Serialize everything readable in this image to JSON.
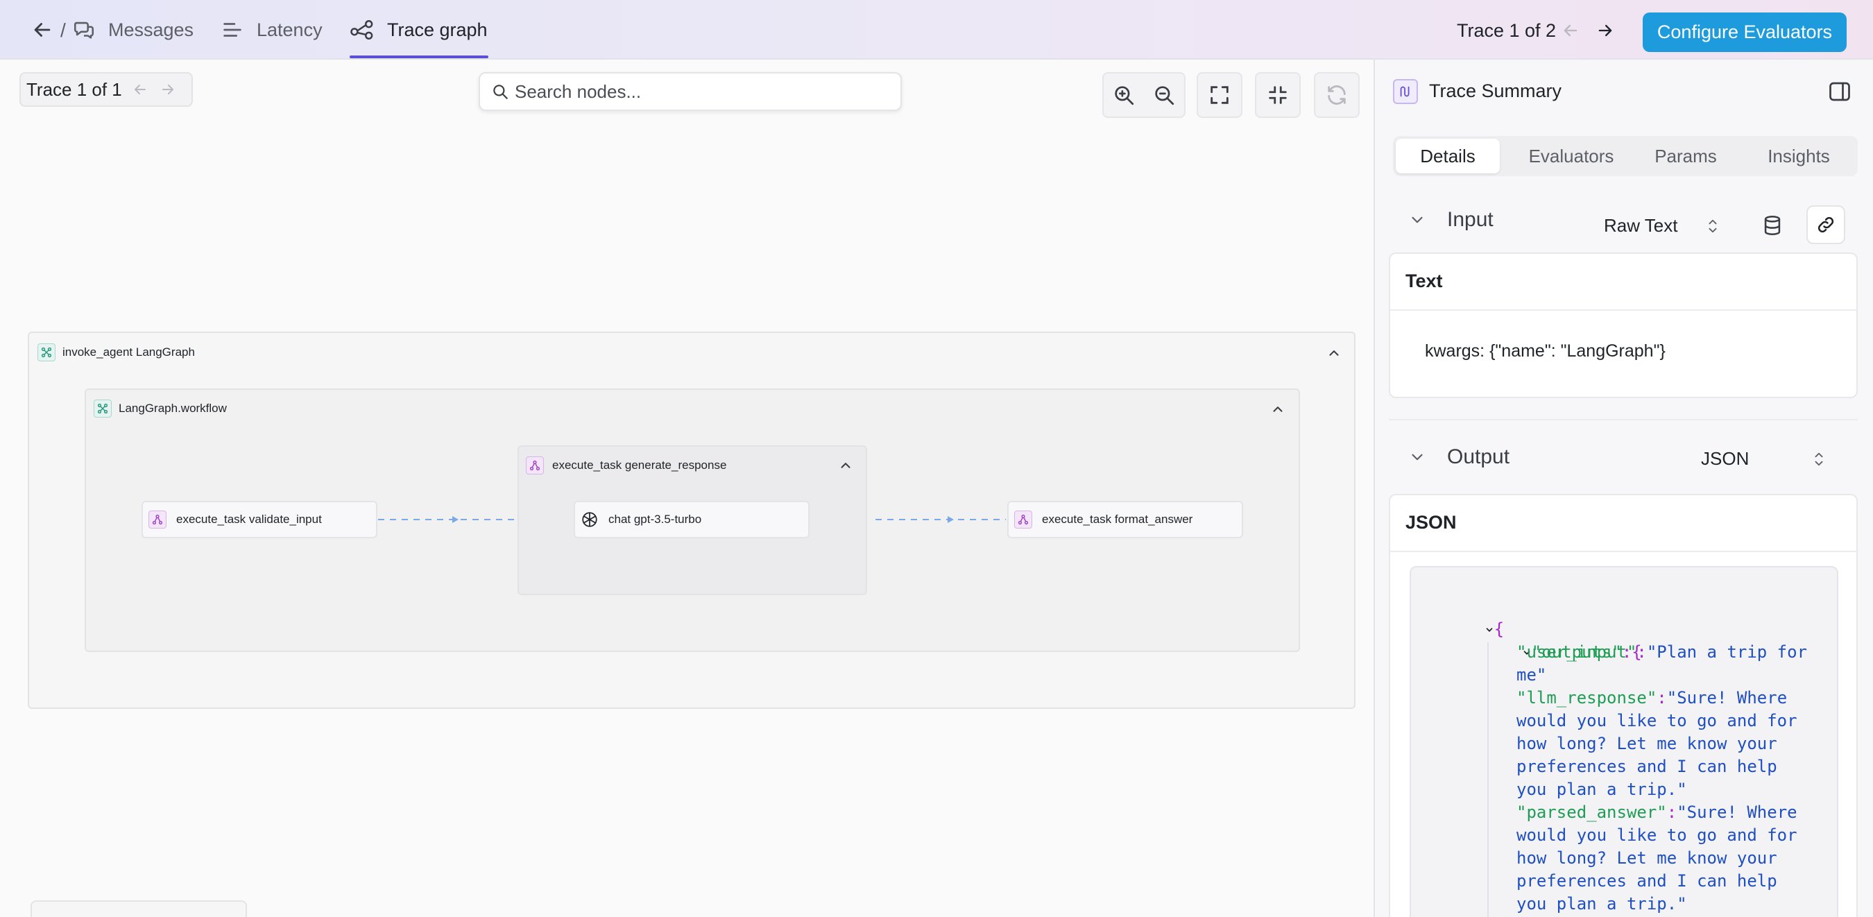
{
  "header": {
    "breadcrumb_sep": "/",
    "tabs": [
      {
        "label": "Messages"
      },
      {
        "label": "Latency"
      },
      {
        "label": "Trace graph"
      }
    ],
    "trace_counter": "Trace 1 of 2",
    "configure_label": "Configure Evaluators"
  },
  "canvas": {
    "trace_pill": "Trace 1 of 1",
    "search_placeholder": "Search nodes...",
    "groups": {
      "invoke_agent": "invoke_agent LangGraph",
      "workflow": "LangGraph.workflow",
      "generate": "execute_task generate_response"
    },
    "nodes": {
      "validate": "execute_task validate_input",
      "chat": "chat gpt-3.5-turbo",
      "format": "execute_task format_answer"
    }
  },
  "panel": {
    "title": "Trace Summary",
    "tabs": [
      "Details",
      "Evaluators",
      "Params",
      "Insights"
    ],
    "input": {
      "label": "Input",
      "format": "Raw Text",
      "card_title": "Text",
      "content": "kwargs: {\"name\": \"LangGraph\"}"
    },
    "output": {
      "label": "Output",
      "format": "JSON",
      "card_title": "JSON",
      "json": {
        "open_brace": "{",
        "outputs_key": "\"outputs\"",
        "colon": ":",
        "user_input_key": "\"user_input\"",
        "user_input_val_1": "\"Plan a trip for",
        "user_input_val_2": "me\"",
        "llm_key": "\"llm_response\"",
        "llm_val_1": "\"Sure! Where",
        "llm_val_2": "would you like to go and for",
        "llm_val_3": "how long? Let me know your",
        "llm_val_4": "preferences and I can help",
        "llm_val_5": "you plan a trip.\"",
        "parsed_key": "\"parsed_answer\"",
        "parsed_val_1": "\"Sure! Where",
        "parsed_val_2": "would you like to go and for",
        "parsed_val_3": "how long? Let me know your",
        "parsed_val_4": "preferences and I can help",
        "parsed_val_5": "you plan a trip.\""
      }
    }
  },
  "colors": {
    "accent": "#1d9bdd",
    "tab_underline": "#5b4fd8",
    "json_key": "#1f9d55",
    "json_value": "#1f4fc0",
    "json_brace": "#a526c9"
  }
}
